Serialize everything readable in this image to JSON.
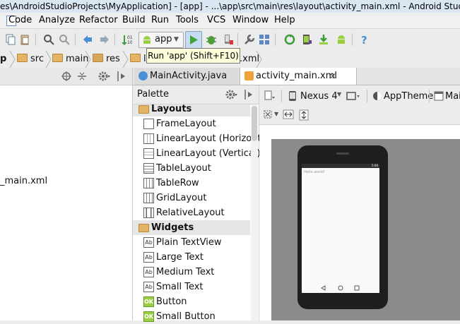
{
  "window": {
    "title": "es\\AndroidStudioProjects\\MyApplication] - [app] - ...\\app\\src\\main\\res\\layout\\activity_main.xml - Android Studio"
  },
  "menu": {
    "items": [
      "Code",
      "Analyze",
      "Refactor",
      "Build",
      "Run",
      "Tools",
      "VCS",
      "Window",
      "Help"
    ]
  },
  "toolbar": {
    "run_config": "app",
    "tooltip": "Run 'app' (Shift+F10)"
  },
  "breadcrumb": {
    "items": [
      "p",
      "src",
      "main",
      "res",
      "la",
      ".xml"
    ]
  },
  "project_panel": {
    "file_label": "_main.xml"
  },
  "editor_tabs": {
    "tabs": [
      "MainActivity.java",
      "activity_main.xml"
    ]
  },
  "palette": {
    "title": "Palette",
    "groups": [
      {
        "label": "Layouts",
        "items": [
          "FrameLayout",
          "LinearLayout (Horizonta",
          "LinearLayout (Vertical)",
          "TableLayout",
          "TableRow",
          "GridLayout",
          "RelativeLayout"
        ]
      },
      {
        "label": "Widgets",
        "items": [
          "Plain TextView",
          "Large Text",
          "Medium Text",
          "Small Text",
          "Button",
          "Small Button"
        ]
      }
    ],
    "icon_glyphs": {
      "textview": "Ab",
      "button": "OK"
    }
  },
  "designer": {
    "device": "Nexus 4",
    "theme": "AppTheme",
    "activity": "Mai",
    "preview_text": "Hello world!",
    "clock": "5:00"
  },
  "colors": {
    "run_green": "#3fa33a",
    "android_green": "#9bcf3f",
    "folder": "#e2b464"
  }
}
